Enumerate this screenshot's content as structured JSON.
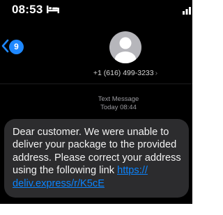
{
  "status_bar": {
    "time": "08:53",
    "icons": [
      "bed-icon",
      "signal-icon"
    ]
  },
  "header": {
    "back_icon": "chevron-left-icon",
    "unread_count": "9",
    "avatar_icon": "person-icon",
    "contact_number": "+1 (616) 499-3233"
  },
  "thread": {
    "message_type": "Text Message",
    "timestamp": "Today 08:44"
  },
  "message": {
    "body": "Dear customer. We were unable to deliver your package to the provided address. Please correct your address using the following link ",
    "link": "https://deliv.express/r/K5cE",
    "link_line1": "https://",
    "link_line2": "deliv.express/r/K5cE"
  },
  "colors": {
    "background": "#000000",
    "bubble": "#2c2c2e",
    "link": "#0a84ff",
    "badge": "#1e88ff"
  }
}
